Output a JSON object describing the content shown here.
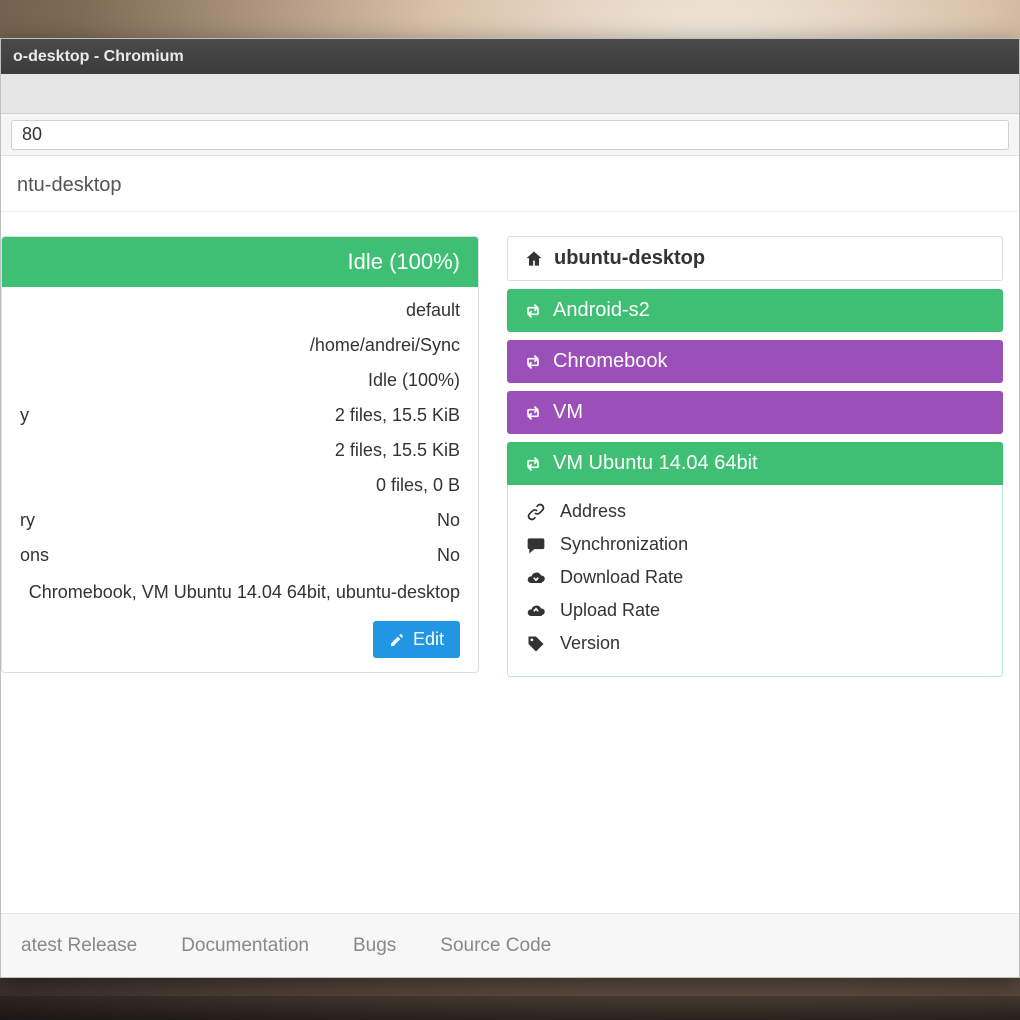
{
  "window": {
    "title": "o-desktop - Chromium",
    "addressbar": "80"
  },
  "breadcrumb": "ntu-desktop",
  "folder_panel": {
    "header": "Idle (100%)",
    "rows": [
      {
        "label": "",
        "value": "default"
      },
      {
        "label": "",
        "value": "/home/andrei/Sync"
      },
      {
        "label": "",
        "value": "Idle (100%)"
      },
      {
        "label": "y",
        "value": "2 files, 15.5 KiB"
      },
      {
        "label": "",
        "value": "2 files, 15.5 KiB"
      },
      {
        "label": "",
        "value": "0 files, 0 B"
      },
      {
        "label": "ry",
        "value": "No"
      },
      {
        "label": "ons",
        "value": "No"
      },
      {
        "label": "",
        "value": "Chromebook, VM Ubuntu 14.04 64bit, ubuntu-desktop"
      }
    ],
    "edit_label": "Edit"
  },
  "devices": {
    "this_device": "ubuntu-desktop",
    "items": [
      {
        "name": "Android-s2",
        "color": "green"
      },
      {
        "name": "Chromebook",
        "color": "purple"
      },
      {
        "name": "VM",
        "color": "purple"
      },
      {
        "name": "VM Ubuntu 14.04 64bit",
        "color": "green",
        "expanded": true
      }
    ],
    "detail_labels": {
      "address": "Address",
      "sync": "Synchronization",
      "download": "Download Rate",
      "upload": "Upload Rate",
      "version": "Version"
    }
  },
  "footer": {
    "links": [
      "atest Release",
      "Documentation",
      "Bugs",
      "Source Code"
    ]
  }
}
